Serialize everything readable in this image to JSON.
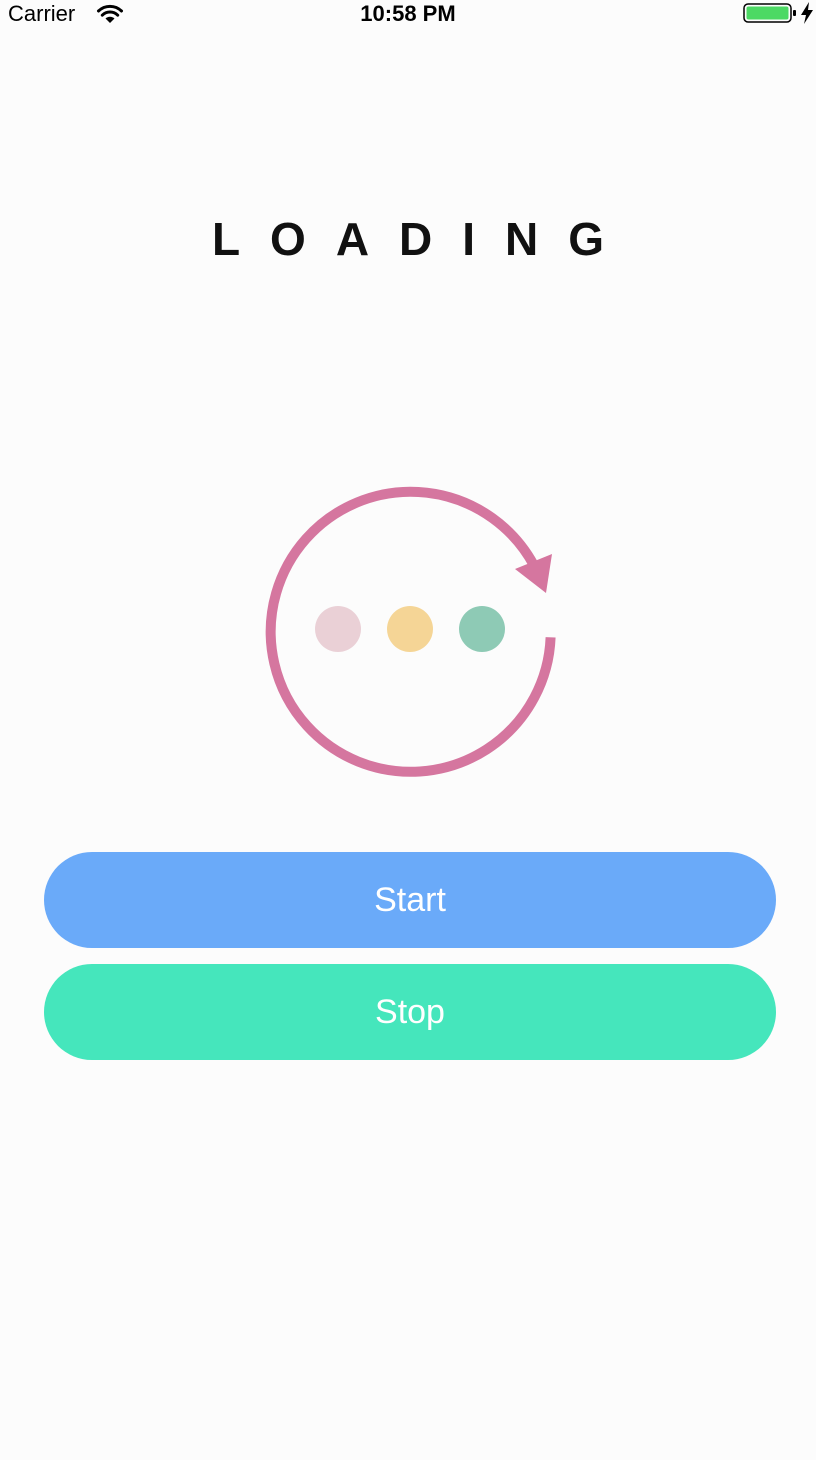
{
  "status_bar": {
    "carrier": "Carrier",
    "time": "10:58 PM",
    "battery_color": "#4cd964"
  },
  "title": "LOADING",
  "loader": {
    "ring_color": "#d5769f",
    "dot_colors": [
      "#ead0d6",
      "#f5d596",
      "#8ecab5"
    ]
  },
  "buttons": {
    "start_label": "Start",
    "stop_label": "Stop",
    "start_color": "#6aaaf9",
    "stop_color": "#45e6bc"
  }
}
